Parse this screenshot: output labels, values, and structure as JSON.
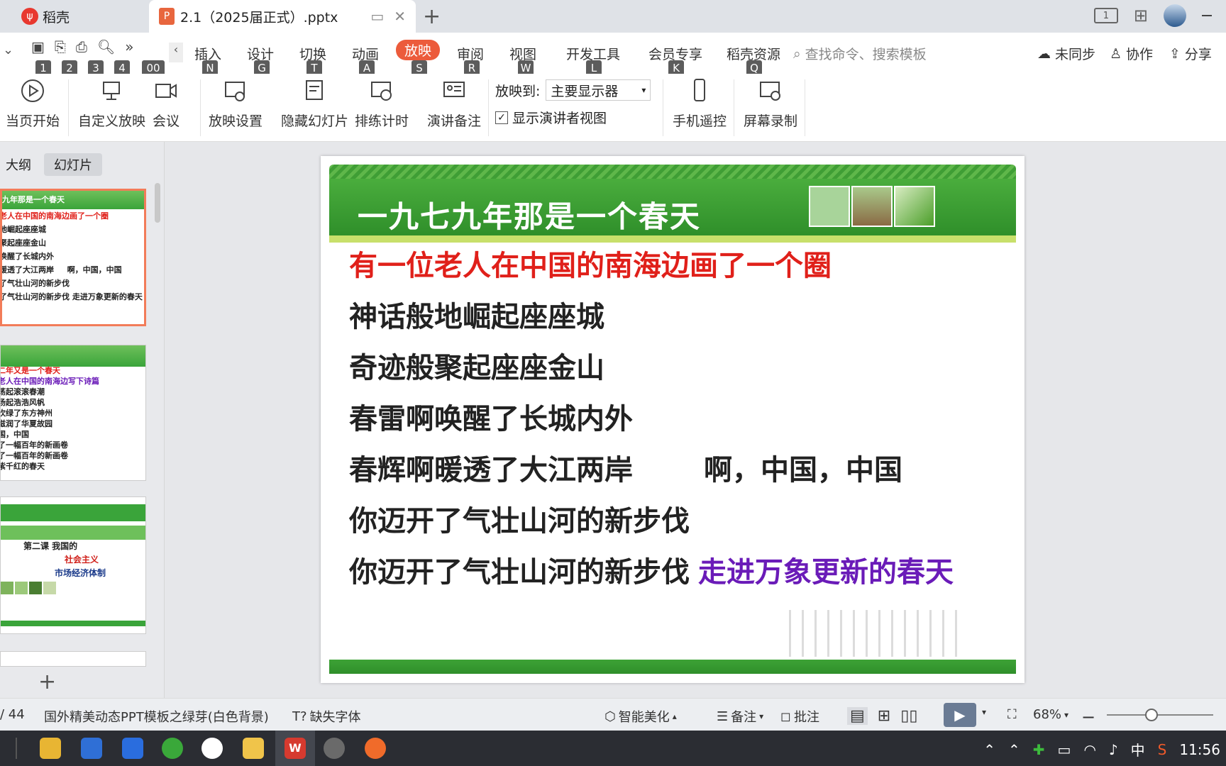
{
  "tabs": {
    "home_label": "稻壳",
    "doc_label": "2.1（2025届正式）.pptx"
  },
  "titlebar": {
    "pages_icon_text": "1"
  },
  "menu": {
    "items": [
      {
        "label": "插入",
        "key": "N"
      },
      {
        "label": "设计",
        "key": "G"
      },
      {
        "label": "切换",
        "key": "T"
      },
      {
        "label": "动画",
        "key": "A"
      },
      {
        "label": "放映",
        "key": "S"
      },
      {
        "label": "审阅",
        "key": "R"
      },
      {
        "label": "视图",
        "key": "W"
      },
      {
        "label": "开发工具",
        "key": "L"
      },
      {
        "label": "会员专享",
        "key": "K"
      },
      {
        "label": "稻壳资源",
        "key": "Q"
      }
    ],
    "quick_keys": [
      "1",
      "2",
      "3",
      "4",
      "00"
    ],
    "search_placeholder": "查找命令、搜索模板",
    "sync": "未同步",
    "collab": "协作",
    "share": "分享"
  },
  "ribbon": {
    "from_current": "当页开始",
    "custom_show": "自定义放映",
    "meeting": "会议",
    "show_settings": "放映设置",
    "hide_slide": "隐藏幻灯片",
    "rehearse": "排练计时",
    "speaker_notes": "演讲备注",
    "show_to_label": "放映到:",
    "show_to_value": "主要显示器",
    "presenter_view": "显示演讲者视图",
    "phone_remote": "手机遥控",
    "screen_record": "屏幕录制"
  },
  "panel": {
    "tab_outline": "大纲",
    "tab_slides": "幻灯片",
    "thumb1": [
      "九年那是一个春天",
      "老人在中国的南海边画了一个圈",
      "地崛起座座城",
      "聚起座座金山",
      "唤醒了长城内外",
      "暖透了大江两岸 　 啊，中国，中国",
      "了气壮山河的新步伐",
      "了气壮山河的新步伐 走进万象更新的春天"
    ],
    "thumb2": [
      "二年又是一个春天",
      "老人在中国的南海边写下诗篇",
      "荡起滚滚春潮",
      "扬起浩浩风帆",
      "吹绿了东方神州",
      "滋润了华夏故园",
      "国，中国",
      "了一幅百年的新画卷",
      "了一幅百年的新画卷",
      "紫千红的春天"
    ],
    "thumb3": [
      "第二课 我国的",
      "社会主义",
      "市场经济体制"
    ]
  },
  "slide": {
    "title": "一九七九年那是一个春天",
    "lines": [
      "有一位老人在中国的南海边画了一个圈",
      "神话般地崛起座座城",
      "奇迹般聚起座座金山",
      "春雷啊唤醒了长城内外",
      "春辉啊暖透了大江两岸",
      "你迈开了气壮山河的新步伐",
      "你迈开了气壮山河的新步伐"
    ],
    "exclaim": "啊，中国，中国",
    "tail": "走进万象更新的春天"
  },
  "status": {
    "page": "/ 44",
    "template": "国外精美动态PPT模板之绿芽(白色背景)",
    "missing_font": "缺失字体",
    "beautify": "智能美化",
    "notes": "备注",
    "comment": "批注",
    "zoom": "68%"
  },
  "taskbar": {
    "ime": "中",
    "time": "11:56"
  },
  "colors": {
    "accent": "#ec5b3b",
    "slide_green": "#3aa43a",
    "red_text": "#e0201a",
    "purple_text": "#6a1bb8"
  }
}
